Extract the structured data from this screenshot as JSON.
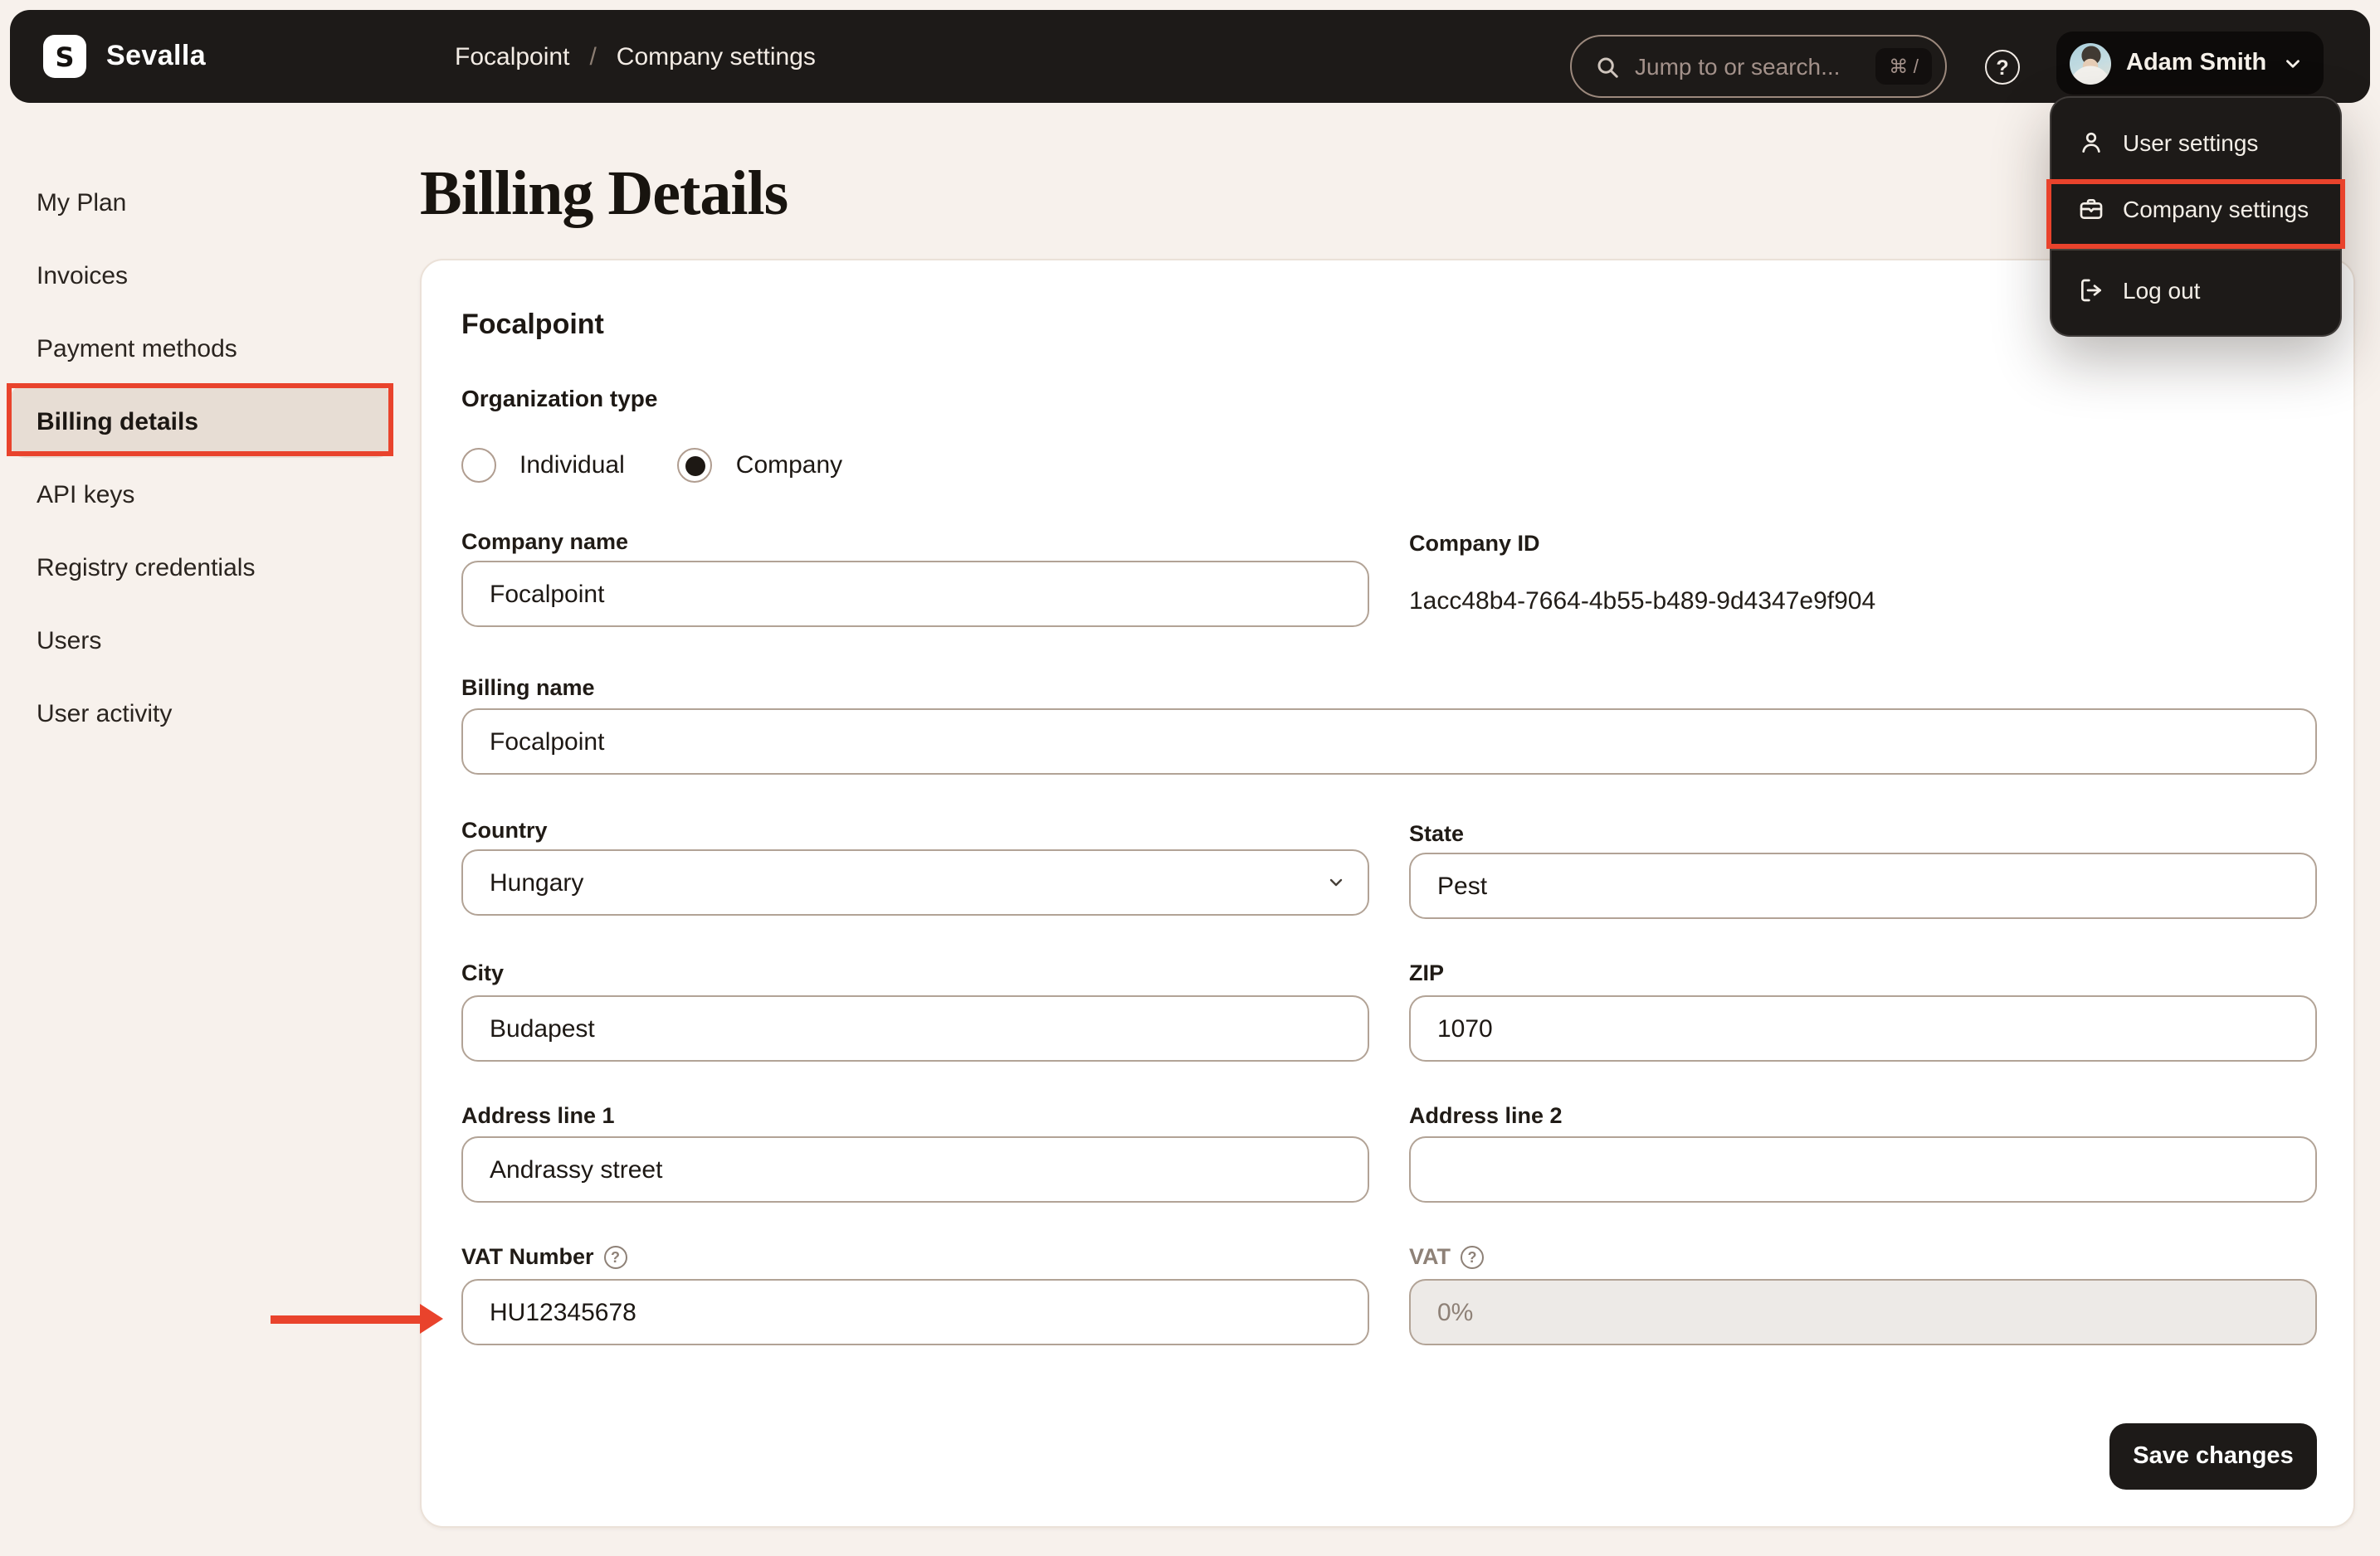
{
  "topbar": {
    "brand": "Sevalla",
    "logo_letter": "S",
    "breadcrumb": {
      "org": "Focalpoint",
      "separator": "/",
      "page": "Company settings"
    },
    "search": {
      "placeholder": "Jump to or search...",
      "shortcut": "⌘ /"
    },
    "help_glyph": "?",
    "user": {
      "name": "Adam Smith"
    }
  },
  "user_menu": {
    "items": [
      {
        "label": "User settings"
      },
      {
        "label": "Company settings",
        "annotated": true
      },
      {
        "label": "Log out"
      }
    ]
  },
  "sidebar": {
    "items": [
      {
        "label": "My Plan"
      },
      {
        "label": "Invoices"
      },
      {
        "label": "Payment methods"
      },
      {
        "label": "Billing details",
        "active": true,
        "annotated": true
      },
      {
        "label": "API keys"
      },
      {
        "label": "Registry credentials"
      },
      {
        "label": "Users"
      },
      {
        "label": "User activity"
      }
    ]
  },
  "page": {
    "title": "Billing Details"
  },
  "form": {
    "card_title": "Focalpoint",
    "org_type": {
      "label": "Organization type",
      "options": [
        {
          "label": "Individual",
          "selected": false
        },
        {
          "label": "Company",
          "selected": true
        }
      ]
    },
    "company_name": {
      "label": "Company name",
      "value": "Focalpoint"
    },
    "company_id": {
      "label": "Company ID",
      "value": "1acc48b4-7664-4b55-b489-9d4347e9f904"
    },
    "billing_name": {
      "label": "Billing name",
      "value": "Focalpoint"
    },
    "country": {
      "label": "Country",
      "value": "Hungary"
    },
    "state": {
      "label": "State",
      "value": "Pest"
    },
    "city": {
      "label": "City",
      "value": "Budapest"
    },
    "zip": {
      "label": "ZIP",
      "value": "1070"
    },
    "address1": {
      "label": "Address line 1",
      "value": "Andrassy street"
    },
    "address2": {
      "label": "Address line 2",
      "value": ""
    },
    "vat_number": {
      "label": "VAT Number",
      "value": "HU12345678"
    },
    "vat": {
      "label": "VAT",
      "value": "0%",
      "disabled": true
    },
    "save_label": "Save changes"
  },
  "colors": {
    "accent_red": "#e9432c",
    "topbar_dark": "#1d1a18",
    "page_bg": "#f7f1ec",
    "sidebar_active_bg": "#e7ddd4",
    "input_border": "#b2a396",
    "muted_text": "#8e8177"
  }
}
